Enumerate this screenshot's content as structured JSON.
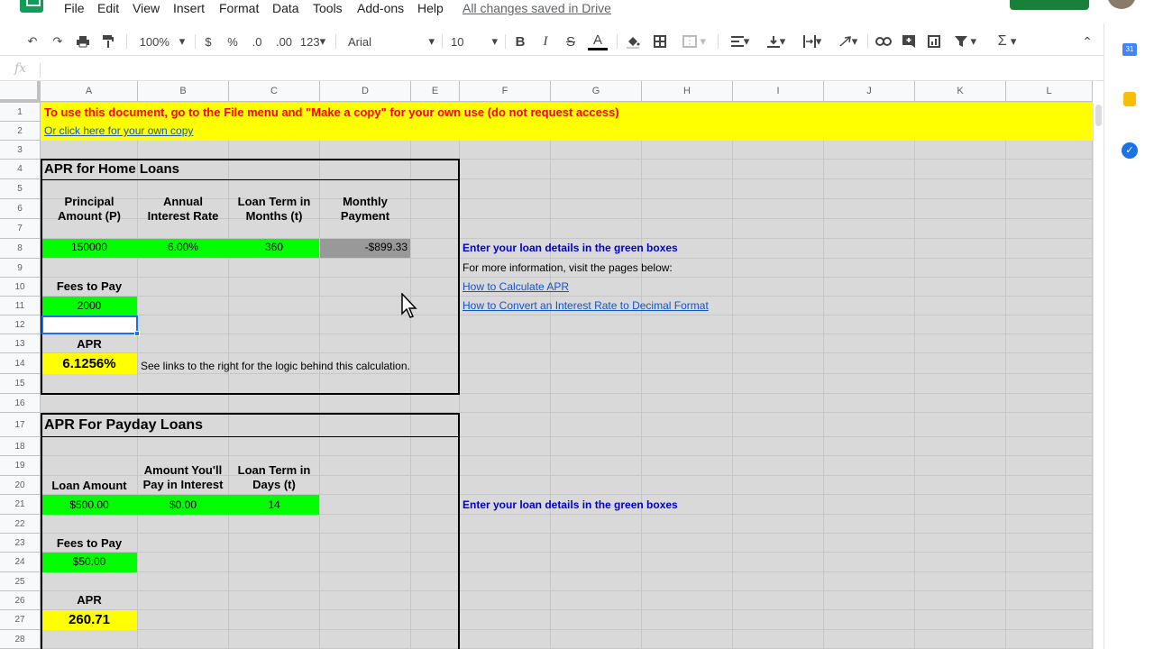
{
  "menu": [
    "File",
    "Edit",
    "View",
    "Insert",
    "Format",
    "Data",
    "Tools",
    "Add-ons",
    "Help"
  ],
  "save_status": "All changes saved in Drive",
  "toolbar": {
    "zoom": "100%",
    "currency": "$",
    "percent": "%",
    "dec_less": ".0",
    "dec_more": ".00",
    "more_formats": "123",
    "font": "Arial",
    "font_size": "10",
    "bold": "B",
    "italic": "I",
    "strike": "S",
    "text_color": "A"
  },
  "formula": {
    "fx": "fx",
    "value": ""
  },
  "columns": [
    "A",
    "B",
    "C",
    "D",
    "E",
    "F",
    "G",
    "H",
    "I",
    "J",
    "K",
    "L"
  ],
  "rows": [
    "1",
    "2",
    "3",
    "4",
    "5",
    "6",
    "7",
    "8",
    "9",
    "10",
    "11",
    "12",
    "13",
    "14",
    "15",
    "16",
    "17",
    "18",
    "19",
    "20",
    "21",
    "22",
    "23",
    "24",
    "25",
    "26",
    "27",
    "28"
  ],
  "sheet": {
    "r1": "To use this document, go to the File menu and \"Make a copy\" for your own use (do not request access)",
    "r2": "Or click here for your own copy",
    "home": {
      "title": "APR for Home Loans",
      "h_principal_1": "Principal",
      "h_principal_2": "Amount (P)",
      "h_rate_1": "Annual",
      "h_rate_2": "Interest Rate",
      "h_term_1": "Loan Term in",
      "h_term_2": "Months (t)",
      "h_payment_1": "Monthly",
      "h_payment_2": "Payment",
      "principal": "150000",
      "rate": "6.00%",
      "term": "360",
      "payment": "-$899.33",
      "fees_label": "Fees to Pay",
      "fees": "2000",
      "apr_label": "APR",
      "apr": "6.1256%",
      "note": "See links to the right for the logic behind this calculation."
    },
    "side": {
      "enter": "Enter your loan details in the green boxes",
      "more_info": "For more information, visit the pages below:",
      "link1": "How to Calculate APR",
      "link2": "How to Convert an Interest Rate to Decimal Format",
      "enter2": "Enter your loan details in the green boxes"
    },
    "payday": {
      "title": "APR For Payday Loans",
      "h_amount": "Loan Amount",
      "h_interest_1": "Amount You'll",
      "h_interest_2": "Pay in Interest",
      "h_term_1": "Loan Term in",
      "h_term_2": "Days (t)",
      "amount": "$500.00",
      "interest": "$0.00",
      "term": "14",
      "fees_label": "Fees to Pay",
      "fees": "$50.00",
      "apr_label": "APR",
      "apr": "260.71"
    }
  },
  "colors": {
    "yellow": "#ffff00",
    "green": "#00ff00",
    "gray_cell": "#999999",
    "red_text": "#ff0000",
    "blue_text": "#0000cc",
    "link": "#1155cc",
    "grid_bg": "#d9d9d9"
  }
}
